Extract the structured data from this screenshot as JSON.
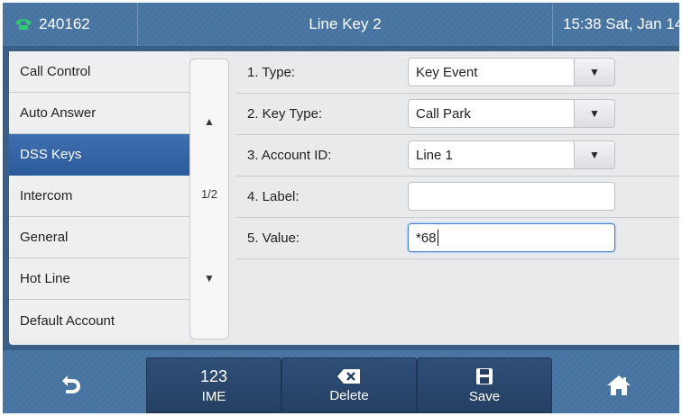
{
  "status": {
    "line_number": "240162",
    "title": "Line Key 2",
    "clock": "15:38 Sat, Jan 14"
  },
  "menu": {
    "items": [
      {
        "label": "Call Control"
      },
      {
        "label": "Auto Answer"
      },
      {
        "label": "DSS Keys"
      },
      {
        "label": "Intercom"
      },
      {
        "label": "General"
      },
      {
        "label": "Hot Line"
      },
      {
        "label": "Default Account"
      }
    ],
    "active_index": 2
  },
  "pager": {
    "up": "▲",
    "page": "1/2",
    "down": "▼"
  },
  "form": {
    "type_label": "1. Type:",
    "type_value": "Key Event",
    "key_type_label": "2. Key Type:",
    "key_type_value": "Call Park",
    "account_label": "3. Account ID:",
    "account_value": "Line 1",
    "label_label": "4. Label:",
    "label_value": "",
    "value_label": "5. Value:",
    "value_value": "*68",
    "dropdown_glyph": "▼"
  },
  "softkeys": {
    "ime_top": "123",
    "ime_bottom": "IME",
    "delete": "Delete",
    "save": "Save"
  },
  "colors": {
    "accent": "#2c5b9c",
    "bar": "#4673a0",
    "panel": "#e9eaec",
    "phone_icon": "#2ecc71"
  }
}
